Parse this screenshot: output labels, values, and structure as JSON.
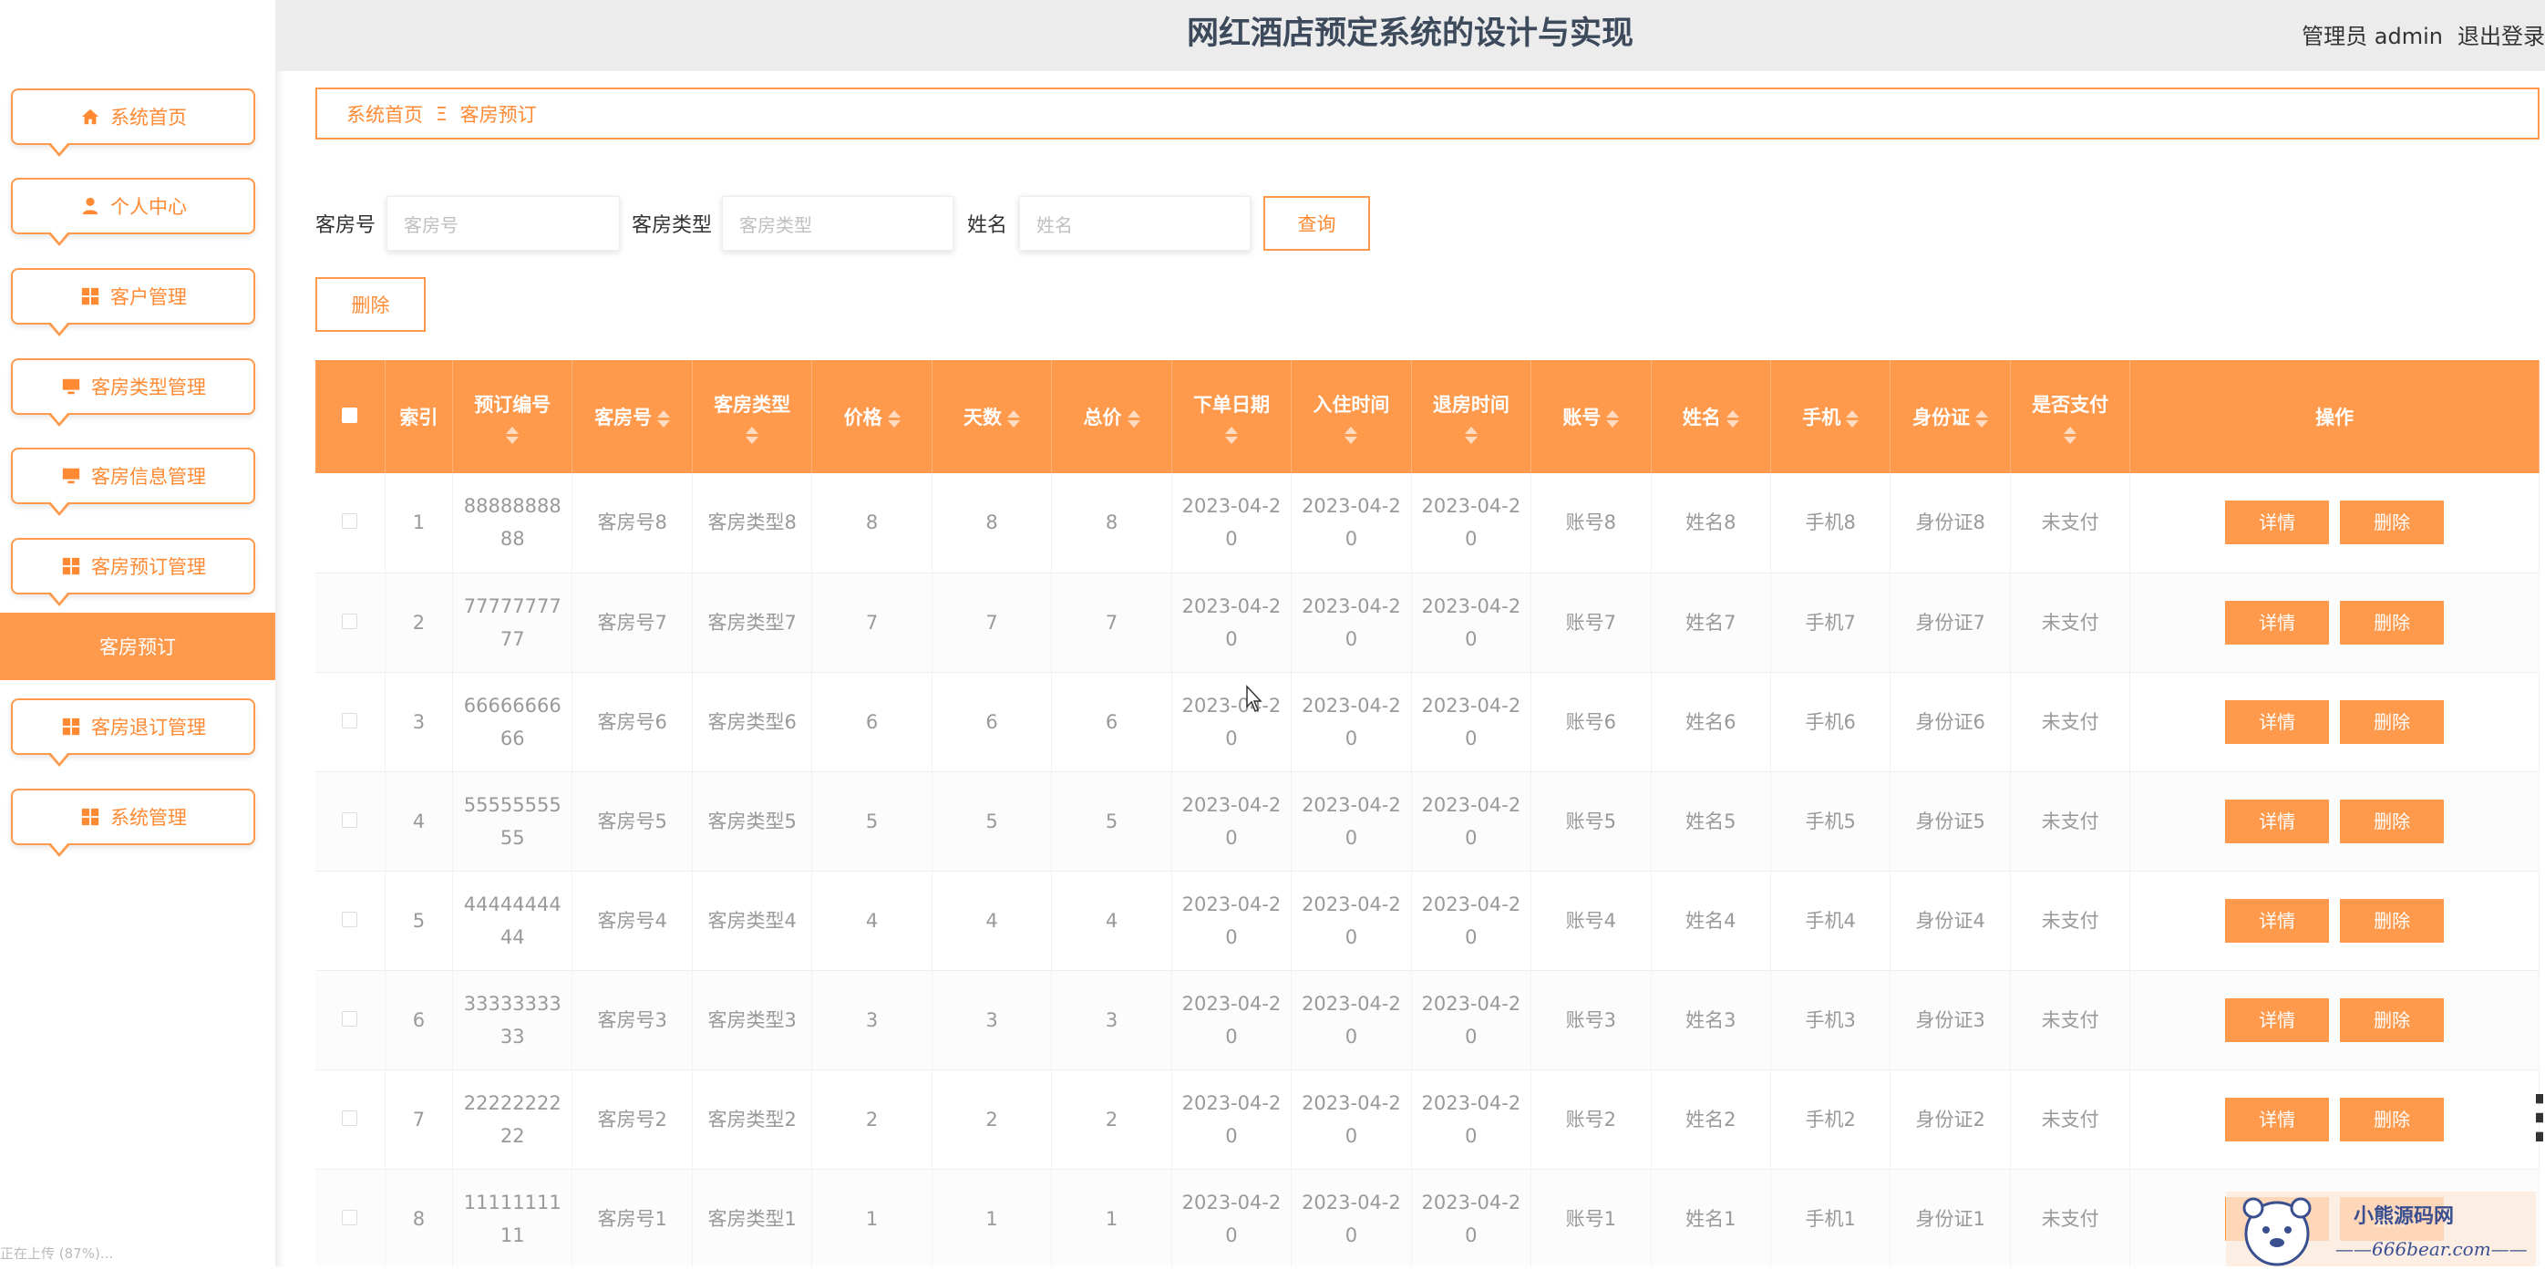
{
  "header": {
    "title": "网红酒店预定系统的设计与实现",
    "user": "管理员 admin",
    "logout": "退出登录"
  },
  "sidebar": {
    "items": [
      {
        "label": "系统首页",
        "icon": "home-icon"
      },
      {
        "label": "个人中心",
        "icon": "user-icon"
      },
      {
        "label": "客户管理",
        "icon": "grid-icon"
      },
      {
        "label": "客房类型管理",
        "icon": "monitor-icon"
      },
      {
        "label": "客房信息管理",
        "icon": "monitor-icon"
      },
      {
        "label": "客房预订管理",
        "icon": "grid-icon"
      },
      {
        "label": "客房退订管理",
        "icon": "grid-icon"
      },
      {
        "label": "系统管理",
        "icon": "grid-icon"
      }
    ],
    "active_sub": "客房预订",
    "status": "正在上传 (87%)..."
  },
  "breadcrumb": {
    "home": "系统首页",
    "separator": "Ξ",
    "current": "客房预订"
  },
  "search": {
    "room_no_label": "客房号",
    "room_no_placeholder": "客房号",
    "room_type_label": "客房类型",
    "room_type_placeholder": "客房类型",
    "name_label": "姓名",
    "name_placeholder": "姓名",
    "query_button": "查询",
    "delete_button": "删除"
  },
  "table": {
    "headers": [
      "索引",
      "预订编号",
      "客房号",
      "客房类型",
      "价格",
      "天数",
      "总价",
      "下单日期",
      "入住时间",
      "退房时间",
      "账号",
      "姓名",
      "手机",
      "身份证",
      "是否支付",
      "操作"
    ],
    "detail_label": "详情",
    "delete_label": "删除",
    "rows": [
      {
        "index": "1",
        "order_no": "8888888888",
        "room_no": "客房号8",
        "room_type": "客房类型8",
        "price": "8",
        "days": "8",
        "total": "8",
        "order_date": "2023-04-20",
        "checkin": "2023-04-20",
        "checkout": "2023-04-20",
        "account": "账号8",
        "name": "姓名8",
        "phone": "手机8",
        "id_card": "身份证8",
        "paid": "未支付"
      },
      {
        "index": "2",
        "order_no": "7777777777",
        "room_no": "客房号7",
        "room_type": "客房类型7",
        "price": "7",
        "days": "7",
        "total": "7",
        "order_date": "2023-04-20",
        "checkin": "2023-04-20",
        "checkout": "2023-04-20",
        "account": "账号7",
        "name": "姓名7",
        "phone": "手机7",
        "id_card": "身份证7",
        "paid": "未支付"
      },
      {
        "index": "3",
        "order_no": "6666666666",
        "room_no": "客房号6",
        "room_type": "客房类型6",
        "price": "6",
        "days": "6",
        "total": "6",
        "order_date": "2023-04-20",
        "checkin": "2023-04-20",
        "checkout": "2023-04-20",
        "account": "账号6",
        "name": "姓名6",
        "phone": "手机6",
        "id_card": "身份证6",
        "paid": "未支付"
      },
      {
        "index": "4",
        "order_no": "5555555555",
        "room_no": "客房号5",
        "room_type": "客房类型5",
        "price": "5",
        "days": "5",
        "total": "5",
        "order_date": "2023-04-20",
        "checkin": "2023-04-20",
        "checkout": "2023-04-20",
        "account": "账号5",
        "name": "姓名5",
        "phone": "手机5",
        "id_card": "身份证5",
        "paid": "未支付"
      },
      {
        "index": "5",
        "order_no": "4444444444",
        "room_no": "客房号4",
        "room_type": "客房类型4",
        "price": "4",
        "days": "4",
        "total": "4",
        "order_date": "2023-04-20",
        "checkin": "2023-04-20",
        "checkout": "2023-04-20",
        "account": "账号4",
        "name": "姓名4",
        "phone": "手机4",
        "id_card": "身份证4",
        "paid": "未支付"
      },
      {
        "index": "6",
        "order_no": "3333333333",
        "room_no": "客房号3",
        "room_type": "客房类型3",
        "price": "3",
        "days": "3",
        "total": "3",
        "order_date": "2023-04-20",
        "checkin": "2023-04-20",
        "checkout": "2023-04-20",
        "account": "账号3",
        "name": "姓名3",
        "phone": "手机3",
        "id_card": "身份证3",
        "paid": "未支付"
      },
      {
        "index": "7",
        "order_no": "2222222222",
        "room_no": "客房号2",
        "room_type": "客房类型2",
        "price": "2",
        "days": "2",
        "total": "2",
        "order_date": "2023-04-20",
        "checkin": "2023-04-20",
        "checkout": "2023-04-20",
        "account": "账号2",
        "name": "姓名2",
        "phone": "手机2",
        "id_card": "身份证2",
        "paid": "未支付"
      },
      {
        "index": "8",
        "order_no": "1111111111",
        "room_no": "客房号1",
        "room_type": "客房类型1",
        "price": "1",
        "days": "1",
        "total": "1",
        "order_date": "2023-04-20",
        "checkin": "2023-04-20",
        "checkout": "2023-04-20",
        "account": "账号1",
        "name": "姓名1",
        "phone": "手机1",
        "id_card": "身份证1",
        "paid": "未支付"
      }
    ]
  },
  "watermark": {
    "name": "小熊源码网",
    "url": "666bear.com"
  },
  "colors": {
    "accent": "#ff9a4d",
    "header_bg": "#ececec",
    "title": "#3d4a5c"
  }
}
